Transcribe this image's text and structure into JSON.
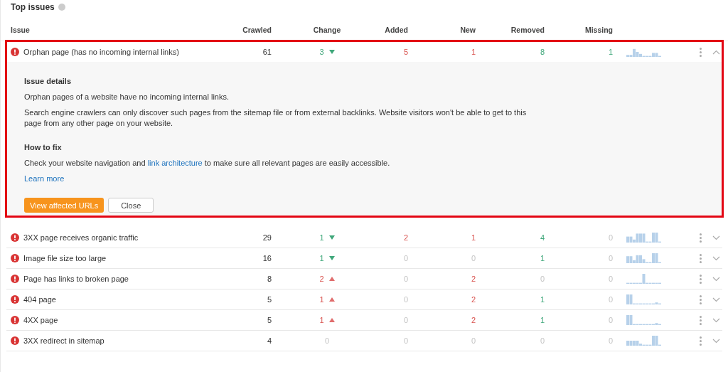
{
  "title": "Top issues",
  "columns": [
    "Issue",
    "Crawled",
    "Change",
    "Added",
    "New",
    "Removed",
    "Missing"
  ],
  "rows": [
    {
      "issue": "Orphan page (has no incoming internal links)",
      "crawled": "61",
      "change": {
        "value": "3",
        "kind": "down"
      },
      "added": {
        "value": "5",
        "muted": false
      },
      "new": {
        "value": "1",
        "muted": false
      },
      "removed": {
        "value": "8",
        "muted": false
      },
      "missing": {
        "value": "1",
        "muted": false
      },
      "expanded": true,
      "highlighted": true
    },
    {
      "issue": "3XX page receives organic traffic",
      "crawled": "29",
      "change": {
        "value": "1",
        "kind": "down"
      },
      "added": {
        "value": "2",
        "muted": false
      },
      "new": {
        "value": "1",
        "muted": false
      },
      "removed": {
        "value": "4",
        "muted": false
      },
      "missing": {
        "value": "0",
        "muted": true
      },
      "expanded": false
    },
    {
      "issue": "Image file size too large",
      "crawled": "16",
      "change": {
        "value": "1",
        "kind": "down"
      },
      "added": {
        "value": "0",
        "muted": true
      },
      "new": {
        "value": "0",
        "muted": true
      },
      "removed": {
        "value": "1",
        "muted": false
      },
      "missing": {
        "value": "0",
        "muted": true
      },
      "expanded": false
    },
    {
      "issue": "Page has links to broken page",
      "crawled": "8",
      "change": {
        "value": "2",
        "kind": "up"
      },
      "added": {
        "value": "0",
        "muted": true
      },
      "new": {
        "value": "2",
        "muted": false
      },
      "removed": {
        "value": "0",
        "muted": true
      },
      "missing": {
        "value": "0",
        "muted": true
      },
      "expanded": false
    },
    {
      "issue": "404 page",
      "crawled": "5",
      "change": {
        "value": "1",
        "kind": "up"
      },
      "added": {
        "value": "0",
        "muted": true
      },
      "new": {
        "value": "2",
        "muted": false
      },
      "removed": {
        "value": "1",
        "muted": false
      },
      "missing": {
        "value": "0",
        "muted": true
      },
      "expanded": false
    },
    {
      "issue": "4XX page",
      "crawled": "5",
      "change": {
        "value": "1",
        "kind": "up"
      },
      "added": {
        "value": "0",
        "muted": true
      },
      "new": {
        "value": "2",
        "muted": false
      },
      "removed": {
        "value": "1",
        "muted": false
      },
      "missing": {
        "value": "0",
        "muted": true
      },
      "expanded": false
    },
    {
      "issue": "3XX redirect in sitemap",
      "crawled": "4",
      "change": {
        "value": "0",
        "kind": "flat"
      },
      "added": {
        "value": "0",
        "muted": true
      },
      "new": {
        "value": "0",
        "muted": true
      },
      "removed": {
        "value": "0",
        "muted": true
      },
      "missing": {
        "value": "0",
        "muted": true
      },
      "expanded": false
    }
  ],
  "details": {
    "heading": "Issue details",
    "description": "Orphan pages of a website have no incoming internal links.",
    "explanation": "Search engine crawlers can only discover such pages from the sitemap file or from external backlinks. Website visitors won't be able to get to this page from any other page on your website.",
    "fix_heading": "How to fix",
    "fix_before": "Check your website navigation and",
    "fix_link": "link architecture",
    "fix_after": "to make sure all relevant pages are easily accessible.",
    "learn_more": "Learn more",
    "primary_button": "View affected URLs",
    "close_button": "Close"
  }
}
